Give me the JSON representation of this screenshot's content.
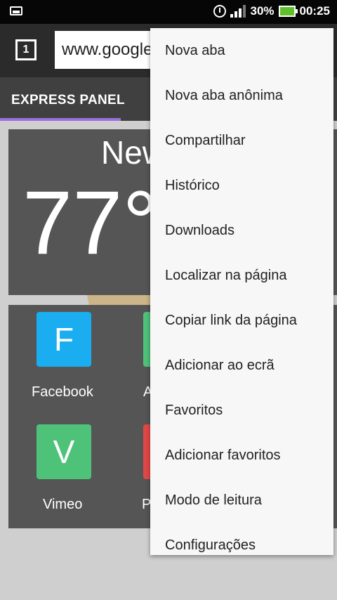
{
  "status_bar": {
    "battery": "30%",
    "time": "00:25",
    "icons": [
      "notification-icon",
      "alarm-icon",
      "signal-icon",
      "battery-charging-icon"
    ]
  },
  "toolbar": {
    "tab_count": "1",
    "url": "www.google"
  },
  "tabs": {
    "active": "EXPRESS PANEL"
  },
  "weather": {
    "city": "New",
    "temperature": "77°"
  },
  "speed_dial": [
    {
      "letter": "F",
      "label": "Facebook",
      "color": "#1aaef0"
    },
    {
      "letter": "",
      "label": "A",
      "color": "#4fc27a"
    },
    {
      "letter": "V",
      "label": "Vimeo",
      "color": "#4fc27a"
    },
    {
      "letter": "",
      "label": "P",
      "color": "#e04848"
    }
  ],
  "menu": {
    "items": [
      "Nova aba",
      "Nova aba anônima",
      "Compartilhar",
      "Histórico",
      "Downloads",
      "Localizar na página",
      "Copiar link da página",
      "Adicionar ao ecrã",
      "Favoritos",
      "Adicionar favoritos",
      "Modo de leitura",
      "Configurações"
    ]
  },
  "colors": {
    "accent": "#9a6ee0",
    "toolbar": "#2b2b2b",
    "tabstrip": "#404040"
  }
}
